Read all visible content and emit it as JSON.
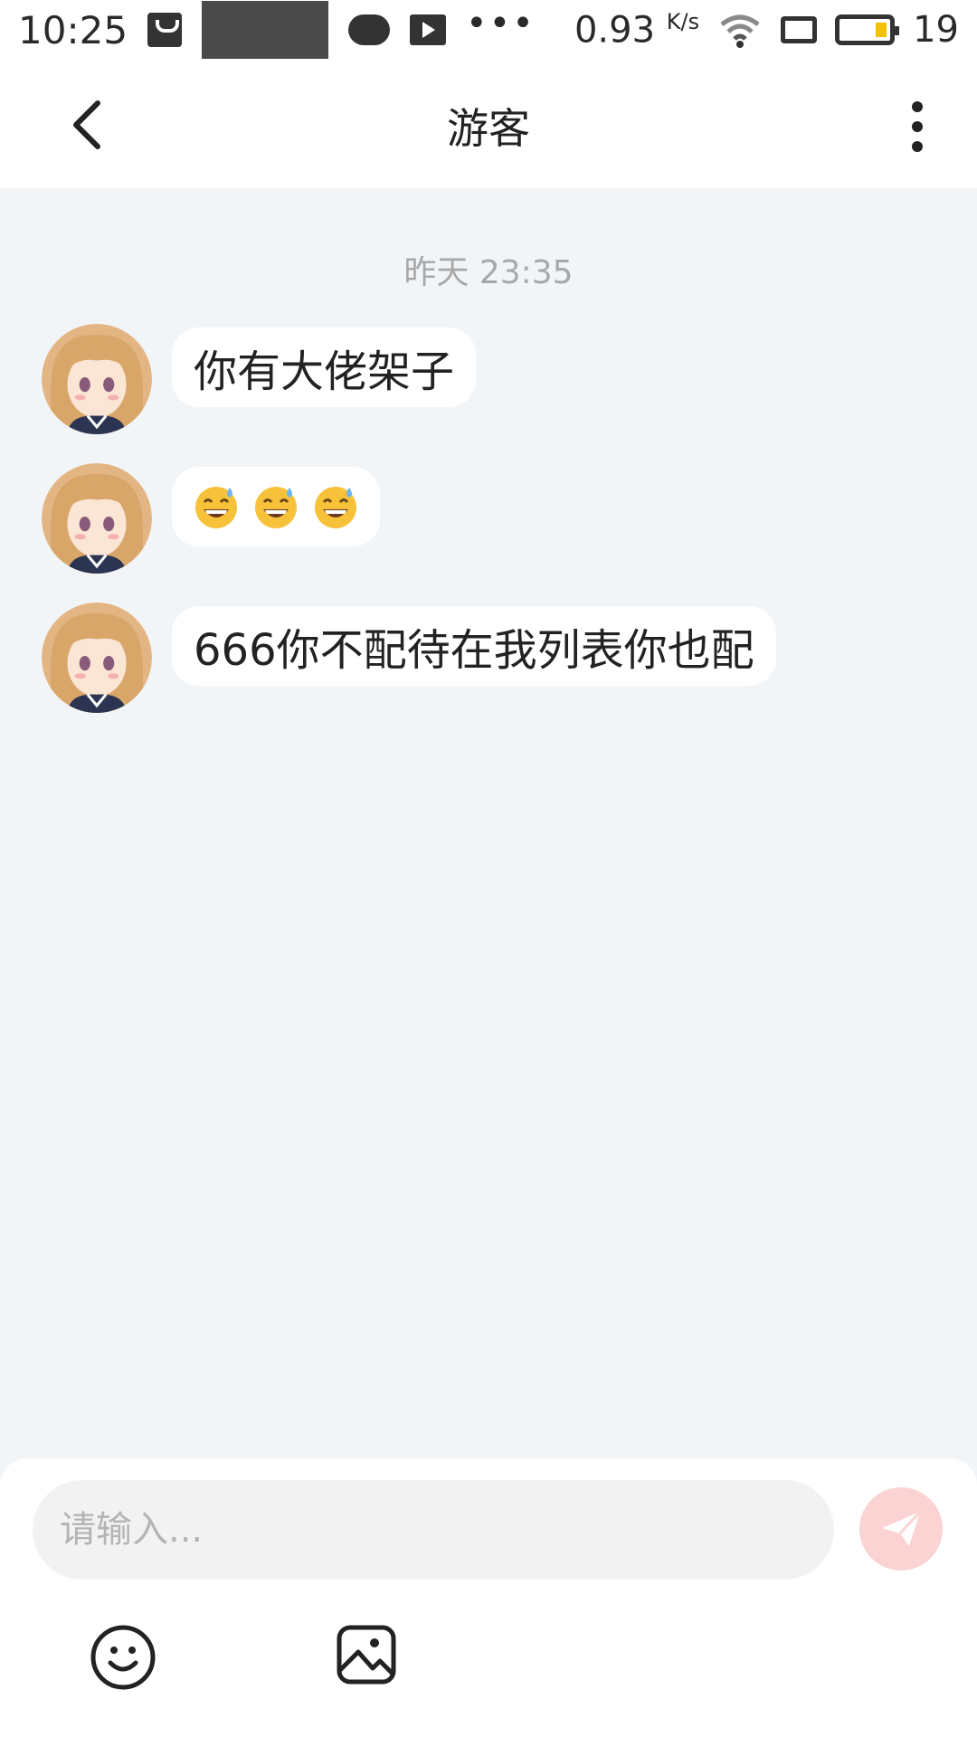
{
  "status_bar": {
    "time": "10:25",
    "speed": "0.93",
    "speed_unit": "K/s",
    "battery_level": "19"
  },
  "header": {
    "title": "游客"
  },
  "chat": {
    "timestamp": "昨天 23:35",
    "messages": [
      {
        "text": "你有大佬架子"
      },
      {
        "emoji_names": [
          "sweat-smile-emoji",
          "sweat-smile-emoji",
          "sweat-smile-emoji"
        ]
      },
      {
        "text": "666你不配待在我列表你也配"
      }
    ]
  },
  "composer": {
    "placeholder": "请输入..."
  },
  "colors": {
    "page_bg": "#f2f5f7",
    "bubble_bg": "#ffffff",
    "send_button": "#fbd3d3",
    "timestamp": "#a8a8a8"
  }
}
